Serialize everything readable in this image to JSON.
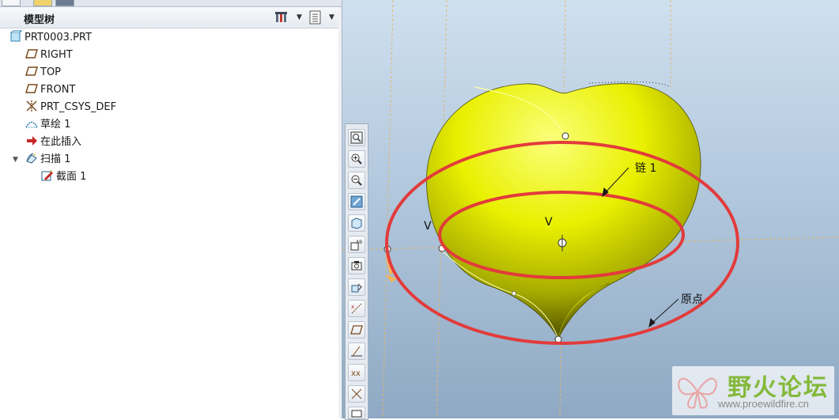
{
  "model_tree": {
    "title": "模型树",
    "items": [
      {
        "label": "PRT0003.PRT",
        "icon": "part-icon"
      },
      {
        "label": "RIGHT",
        "icon": "datum-plane-icon"
      },
      {
        "label": "TOP",
        "icon": "datum-plane-icon"
      },
      {
        "label": "FRONT",
        "icon": "datum-plane-icon"
      },
      {
        "label": "PRT_CSYS_DEF",
        "icon": "csys-icon"
      },
      {
        "label": "草绘 1",
        "icon": "sketch-icon"
      },
      {
        "label": "在此插入",
        "icon": "insert-here-arrow-icon"
      },
      {
        "label": "扫描 1",
        "icon": "sweep-icon",
        "expanded": true
      },
      {
        "label": "截面 1",
        "icon": "section-icon"
      }
    ]
  },
  "viewport": {
    "labels": {
      "vertex_left": "V",
      "vertex_center": "V",
      "chain": "链 1",
      "origin": "原点"
    },
    "colors": {
      "model": "#e9f000",
      "highlight_ring": "#e23b3b",
      "background_top": "#cfe0ef",
      "background_bottom": "#8fa9c4"
    }
  },
  "view_toolbar": {
    "buttons": [
      "refit-icon",
      "zoom-in-icon",
      "zoom-out-icon",
      "repaint-icon",
      "saved-views-icon",
      "annotation-display-icon",
      "view-manager-icon",
      "spin-center-icon",
      "axis-display-icon",
      "plane-display-icon",
      "axis-tag-icon",
      "point-display-icon",
      "csys-display-icon",
      "note-display-icon"
    ]
  },
  "watermark": {
    "title": "野火论坛",
    "url": "www.proewildfire.cn"
  }
}
